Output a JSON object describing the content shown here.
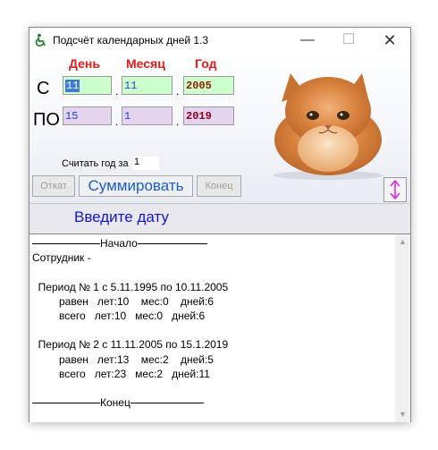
{
  "window": {
    "title": "Подсчёт календарных дней 1.3"
  },
  "headers": {
    "day": "День",
    "month": "Месяц",
    "year": "Год"
  },
  "from": {
    "label": "С",
    "day": "11",
    "month": "11",
    "year": "2005"
  },
  "to": {
    "label": "ПО",
    "day": "15",
    "month": "1",
    "year": "2019"
  },
  "separators": {
    "dot": "."
  },
  "count_year": {
    "label": "Считать год за",
    "value": "1"
  },
  "buttons": {
    "undo": "Откат",
    "sum": "Суммировать",
    "end": "Конец"
  },
  "status": "Введите дату",
  "output": {
    "start": "Начало",
    "employee": "Сотрудник -",
    "p1_title": "  Период № 1 с 5.11.1995 по 10.11.2005",
    "p1_equal": "         равен   лет:10    мес:0    дней:6",
    "p1_total": "         всего   лет:10   мес:0   дней:6",
    "p2_title": "  Период № 2 с 11.11.2005 по 15.1.2019",
    "p2_equal": "         равен   лет:13    мес:2    дней:5",
    "p2_total": "         всего   лет:23   мес:2   дней:11",
    "end": "Конец"
  },
  "colors": {
    "header_red": "#e41b1b",
    "status_blue": "#1515c8",
    "field_green": "#ccffcc",
    "field_purple": "#e4d4ee"
  }
}
